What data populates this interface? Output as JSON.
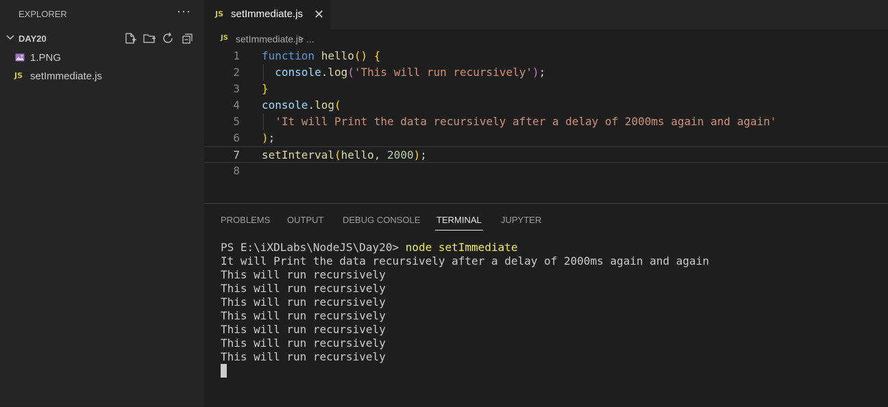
{
  "sidebar": {
    "title": "EXPLORER",
    "more_icon_glyph": "···",
    "folder": {
      "name": "DAY20"
    },
    "files": [
      {
        "name": "1.PNG",
        "icon": "image-file-icon"
      },
      {
        "name": "setImmediate.js",
        "icon": "js-file-icon",
        "badge": "JS"
      }
    ]
  },
  "tabs": [
    {
      "label": "setImmediate.js",
      "badge": "JS",
      "close_glyph": "✕"
    }
  ],
  "breadcrumb": {
    "badge": "JS",
    "file": "setImmediate.js",
    "separator": ">",
    "more": "..."
  },
  "editor": {
    "active_line": 7,
    "lines": [
      {
        "num": "1"
      },
      {
        "num": "2"
      },
      {
        "num": "3"
      },
      {
        "num": "4"
      },
      {
        "num": "5"
      },
      {
        "num": "6"
      },
      {
        "num": "7"
      },
      {
        "num": "8"
      }
    ],
    "tokens": {
      "l1_kw": "function",
      "l1_fn": "hello",
      "l1_parens": "()",
      "l1_brace": "{",
      "l2_var": "console",
      "l2_dot": ".",
      "l2_fn": "log",
      "l2_open": "(",
      "l2_str": "'This will run recursively'",
      "l2_close": ")",
      "l2_semi": ";",
      "l3_brace": "}",
      "l4_var": "console",
      "l4_dot": ".",
      "l4_fn": "log",
      "l4_open": "(",
      "l5_str": "'It will Print the data recursively after a delay of 2000ms again and again'",
      "l6_close": ")",
      "l6_semi": ";",
      "l7_fn": "setInterval",
      "l7_open": "(",
      "l7_arg": "hello",
      "l7_comma": ", ",
      "l7_num": "2000",
      "l7_close": ")",
      "l7_semi": ";"
    }
  },
  "panel": {
    "tabs": [
      {
        "label": "PROBLEMS"
      },
      {
        "label": "OUTPUT"
      },
      {
        "label": "DEBUG CONSOLE"
      },
      {
        "label": "TERMINAL",
        "active": true
      },
      {
        "label": "JUPYTER"
      }
    ]
  },
  "terminal": {
    "prompt": "PS E:\\iXDLabs\\NodeJS\\Day20> ",
    "command": "node setImmediate",
    "output": [
      "It will Print the data recursively after a delay of 2000ms again and again",
      "This will run recursively",
      "This will run recursively",
      "This will run recursively",
      "This will run recursively",
      "This will run recursively",
      "This will run recursively",
      "This will run recursively"
    ]
  },
  "colors": {
    "editor_bg": "#1e1e1e",
    "sidebar_bg": "#252526",
    "js_badge": "#cbcb41",
    "keyword": "#569cd6",
    "function": "#dcdcaa",
    "string": "#ce9178",
    "number": "#b5cea8",
    "variable": "#9cdcfe"
  }
}
